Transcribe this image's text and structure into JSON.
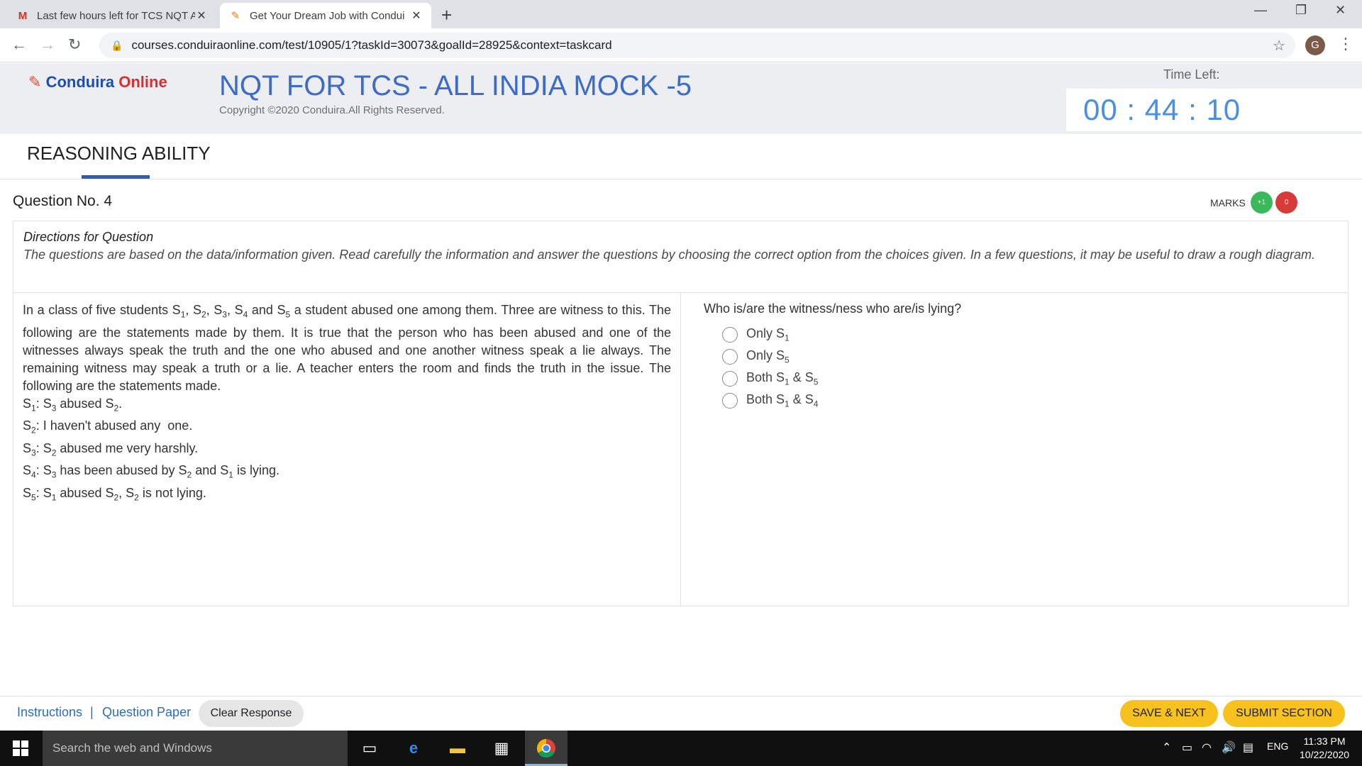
{
  "browser": {
    "tabs": [
      {
        "favicon": "gmail-icon",
        "title": "Last few hours left for TCS NQT A"
      },
      {
        "favicon": "conduira-favicon-icon",
        "title": "Get Your Dream Job with Condui"
      }
    ],
    "url": "courses.conduiraonline.com/test/10905/1?taskId=30073&goalId=28925&context=taskcard",
    "profile_initial": "G"
  },
  "header": {
    "logo_part1": "Conduira ",
    "logo_part2": "Online",
    "exam_title": "NQT FOR TCS - ALL INDIA MOCK -5",
    "copyright": "Copyright ©2020 Conduira.All Rights Reserved.",
    "time_left_label": "Time Left:",
    "timer": "00 : 44 : 10"
  },
  "section": {
    "title": "REASONING ABILITY"
  },
  "question": {
    "number_label": "Question No. 4",
    "marks_label": "MARKS",
    "marks_positive": "+1",
    "marks_negative": "0",
    "directions_heading": "Directions for Question",
    "directions_text": "The questions are based on the data/information given. Read carefully the information and answer the questions by choosing the correct option from the choices given. In a few questions, it may be useful to draw a rough diagram.",
    "question_text": "Who is/are the witness/ness who are/is lying?",
    "selected_option": null
  },
  "bottom_bar": {
    "instructions": "Instructions",
    "separator": "|",
    "question_paper": "Question Paper",
    "clear_response": "Clear Response",
    "save_next": "SAVE & NEXT",
    "submit_section": "SUBMIT SECTION"
  },
  "taskbar": {
    "search_placeholder": "Search the web and Windows",
    "language": "ENG",
    "time": "11:33 PM",
    "date": "10/22/2020"
  },
  "colors": {
    "accent_blue": "#3d6cc8",
    "timer_blue": "#4a90e2",
    "marks_green": "#3cb85c",
    "marks_red": "#d83a3a",
    "button_yellow": "#f7c21d"
  }
}
